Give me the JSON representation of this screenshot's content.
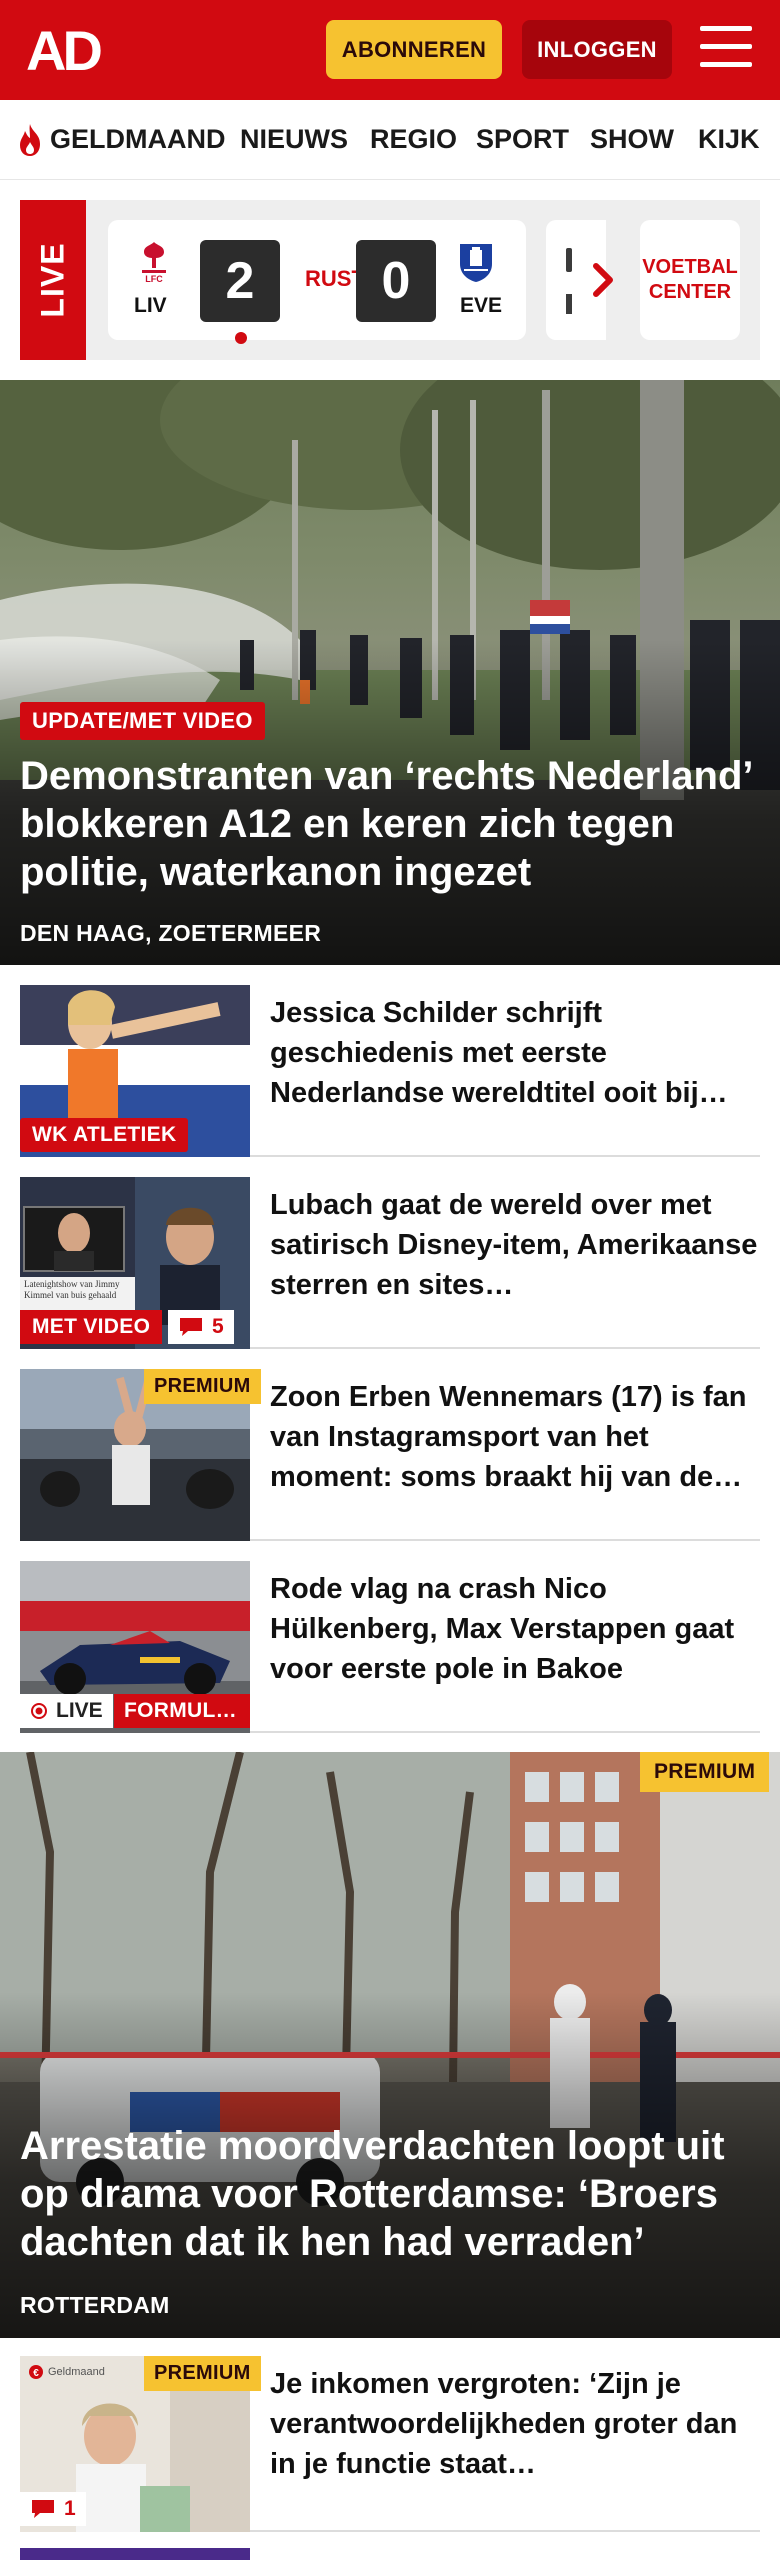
{
  "header": {
    "logo_text": "AD",
    "subscribe_label": "ABONNEREN",
    "login_label": "INLOGGEN",
    "menu_icon": "hamburger-icon",
    "brand_color": "#d10a11"
  },
  "nav": {
    "items": [
      "GELDMAAND",
      "NIEUWS",
      "REGIO",
      "SPORT",
      "SHOW",
      "KIJK"
    ],
    "first_icon": "flame-icon"
  },
  "live": {
    "label": "LIVE",
    "match": {
      "home": "LIV",
      "home_score": "2",
      "status": "RUST",
      "away_score": "0",
      "away": "EVE"
    },
    "football_center_label": "VOETBAL CENTER"
  },
  "hero": {
    "tag": "UPDATE/MET VIDEO",
    "title": "Demonstranten van ‘rechts Nederland’ blokkeren A12 en keren zich tegen politie, waterkanon ingezet",
    "location": "DEN HAAG, ZOETERMEER"
  },
  "articles": [
    {
      "title": "Jessica Schilder schrijft geschiedenis met eerste Nederlandse wereldtitel ooit bij…",
      "label": "WK ATLETIEK"
    },
    {
      "title": "Lubach gaat de wereld over met satirisch Disney-item, Amerikaanse sterren en sites…",
      "label": "MET VIDEO",
      "comments": "5",
      "caption": "Latenightshow van Jimmy Kimmel van buis gehaald"
    },
    {
      "title": "Zoon Erben Wennemars (17) is fan van Instagramsport van het moment: soms braakt hij van de…",
      "premium": "PREMIUM"
    },
    {
      "title": "Rode vlag na crash Nico Hülkenberg, Max Verstappen gaat voor eerste pole in Bakoe",
      "live": "LIVE",
      "label": "FORMUL…"
    }
  ],
  "feature": {
    "premium": "PREMIUM",
    "title": "Arrestatie moordverdachten loopt uit op drama voor Rotterdamse: ‘Broers dachten dat ik hen had verraden’",
    "location": "ROTTERDAM"
  },
  "article_last": {
    "title": "Je inkomen vergroten: ‘Zijn je verantwoordelijkheden groter dan in je functie staat…",
    "premium": "PREMIUM",
    "comments": "1",
    "thumb_label": "Geldmaand"
  }
}
